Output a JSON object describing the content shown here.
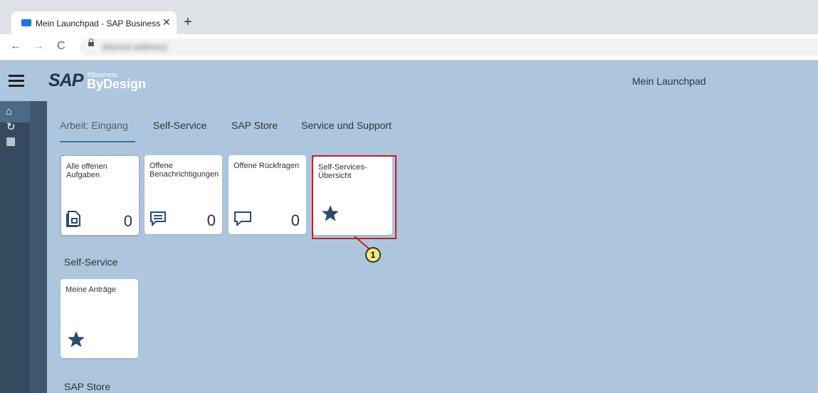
{
  "browser": {
    "tab_title": "Mein Launchpad - SAP Business B",
    "close_glyph": "✕",
    "new_tab_glyph": "+",
    "back_glyph": "←",
    "forward_glyph": "→",
    "reload_glyph": "C",
    "url": "[blurred address]"
  },
  "shell": {
    "logo_sap": "SAP",
    "logo_business": "®Business",
    "logo_bydesign": "ByDesign",
    "title": "Mein Launchpad"
  },
  "sidenav": {
    "icons": [
      "home-icon",
      "refresh-icon",
      "calendar-icon"
    ],
    "glyphs": [
      "⌂",
      "↻",
      "▦"
    ]
  },
  "tabs": [
    {
      "label": "Arbeit: Eingang",
      "active": true
    },
    {
      "label": "Self-Service",
      "active": false
    },
    {
      "label": "SAP Store",
      "active": false
    },
    {
      "label": "Service und Support",
      "active": false
    }
  ],
  "tiles": [
    {
      "title": "Alle offenen Aufgaben",
      "count": "0",
      "icon": "tasks-icon"
    },
    {
      "title": "Offene Benachrichtigungen",
      "count": "0",
      "icon": "notification-icon"
    },
    {
      "title": "Offene Rückfragen",
      "count": "0",
      "icon": "message-icon"
    },
    {
      "title": "Self-Services-Übersicht",
      "count": "",
      "icon": "star-icon"
    }
  ],
  "sections": [
    {
      "title": "Self-Service",
      "tiles": [
        {
          "title": "Meine Anträge",
          "icon": "star-icon"
        }
      ]
    },
    {
      "title": "SAP Store"
    }
  ],
  "callout": {
    "number": "1"
  },
  "colors": {
    "highlight": "#cc1c2b",
    "callout_fill": "#f7e77a",
    "background": "#adc6dd",
    "sidenav": "#34495e",
    "icon": "#2d4b6b"
  }
}
